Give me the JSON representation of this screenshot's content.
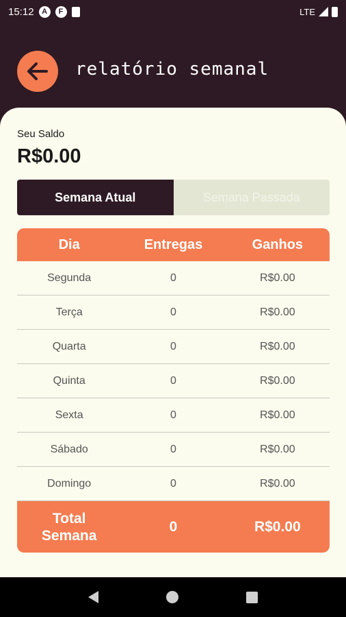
{
  "status_bar": {
    "time": "15:12",
    "icons": [
      "a-icon",
      "f-icon",
      "sd-card-icon"
    ],
    "network": "LTE"
  },
  "header": {
    "title": "relatório semanal",
    "back_icon": "arrow-left-icon"
  },
  "balance": {
    "label": "Seu Saldo",
    "value": "R$0.00"
  },
  "tabs": [
    {
      "label": "Semana Atual",
      "active": true
    },
    {
      "label": "Semana Passada",
      "active": false
    }
  ],
  "table": {
    "headers": [
      "Dia",
      "Entregas",
      "Ganhos"
    ],
    "rows": [
      {
        "day": "Segunda",
        "deliveries": "0",
        "earnings": "R$0.00"
      },
      {
        "day": "Terça",
        "deliveries": "0",
        "earnings": "R$0.00"
      },
      {
        "day": "Quarta",
        "deliveries": "0",
        "earnings": "R$0.00"
      },
      {
        "day": "Quinta",
        "deliveries": "0",
        "earnings": "R$0.00"
      },
      {
        "day": "Sexta",
        "deliveries": "0",
        "earnings": "R$0.00"
      },
      {
        "day": "Sábado",
        "deliveries": "0",
        "earnings": "R$0.00"
      },
      {
        "day": "Domingo",
        "deliveries": "0",
        "earnings": "R$0.00"
      }
    ],
    "footer": {
      "label_line1": "Total",
      "label_line2": "Semana",
      "deliveries": "0",
      "earnings": "R$0.00"
    }
  },
  "colors": {
    "primary_dark": "#2e1a24",
    "accent": "#f47c50",
    "background": "#fbfbee"
  }
}
